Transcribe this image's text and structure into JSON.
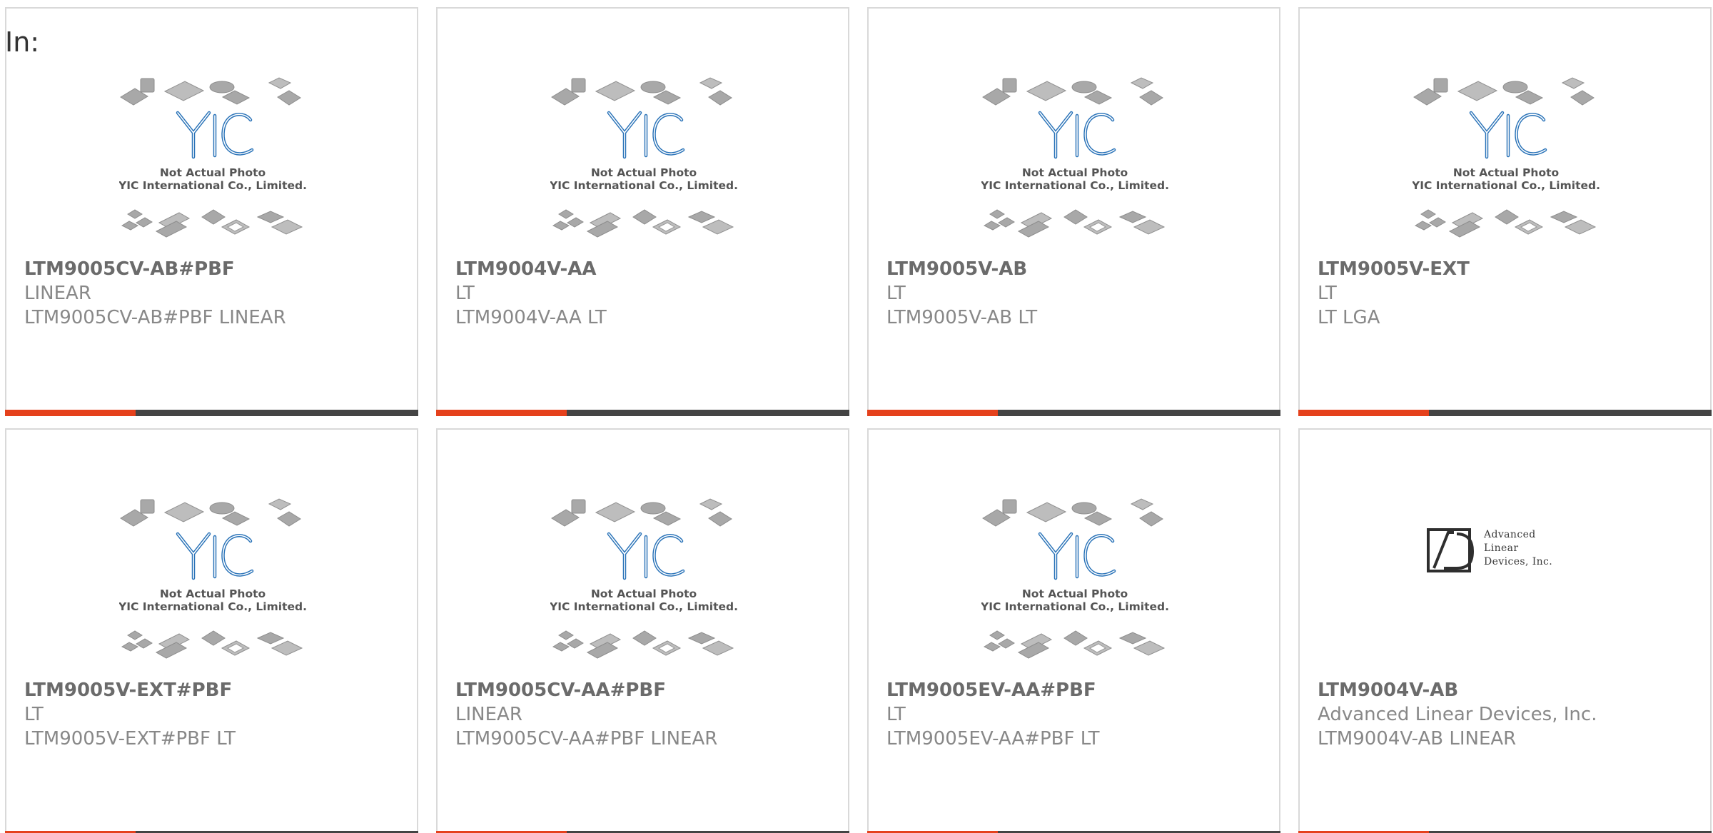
{
  "header": {
    "in_label": "In:"
  },
  "placeholder": {
    "caption_line1": "Not Actual Photo",
    "caption_line2": "YIC International Co., Limited.",
    "logo_text": "YIC"
  },
  "ald_logo": {
    "line1": "Advanced",
    "line2": "Linear",
    "line3": "Devices, Inc."
  },
  "colors": {
    "accent": "#e5411c",
    "bar": "#444444",
    "logo_blue": "#2a73b8"
  },
  "products": [
    {
      "part": "LTM9005CV-AB#PBF",
      "manufacturer": "LINEAR",
      "description": "LTM9005CV-AB#PBF LINEAR",
      "image": "not-actual-photo"
    },
    {
      "part": "LTM9004V-AA",
      "manufacturer": "LT",
      "description": "LTM9004V-AA LT",
      "image": "not-actual-photo"
    },
    {
      "part": "LTM9005V-AB",
      "manufacturer": "LT",
      "description": "LTM9005V-AB LT",
      "image": "not-actual-photo"
    },
    {
      "part": "LTM9005V-EXT",
      "manufacturer": "LT",
      "description": "LT LGA",
      "image": "not-actual-photo"
    },
    {
      "part": "LTM9005V-EXT#PBF",
      "manufacturer": "LT",
      "description": "LTM9005V-EXT#PBF LT",
      "image": "not-actual-photo"
    },
    {
      "part": "LTM9005CV-AA#PBF",
      "manufacturer": "LINEAR",
      "description": "LTM9005CV-AA#PBF LINEAR",
      "image": "not-actual-photo"
    },
    {
      "part": "LTM9005EV-AA#PBF",
      "manufacturer": "LT",
      "description": "LTM9005EV-AA#PBF LT",
      "image": "not-actual-photo"
    },
    {
      "part": "LTM9004V-AB",
      "manufacturer": "Advanced Linear Devices, Inc.",
      "description": "LTM9004V-AB LINEAR",
      "image": "ald-logo"
    }
  ]
}
